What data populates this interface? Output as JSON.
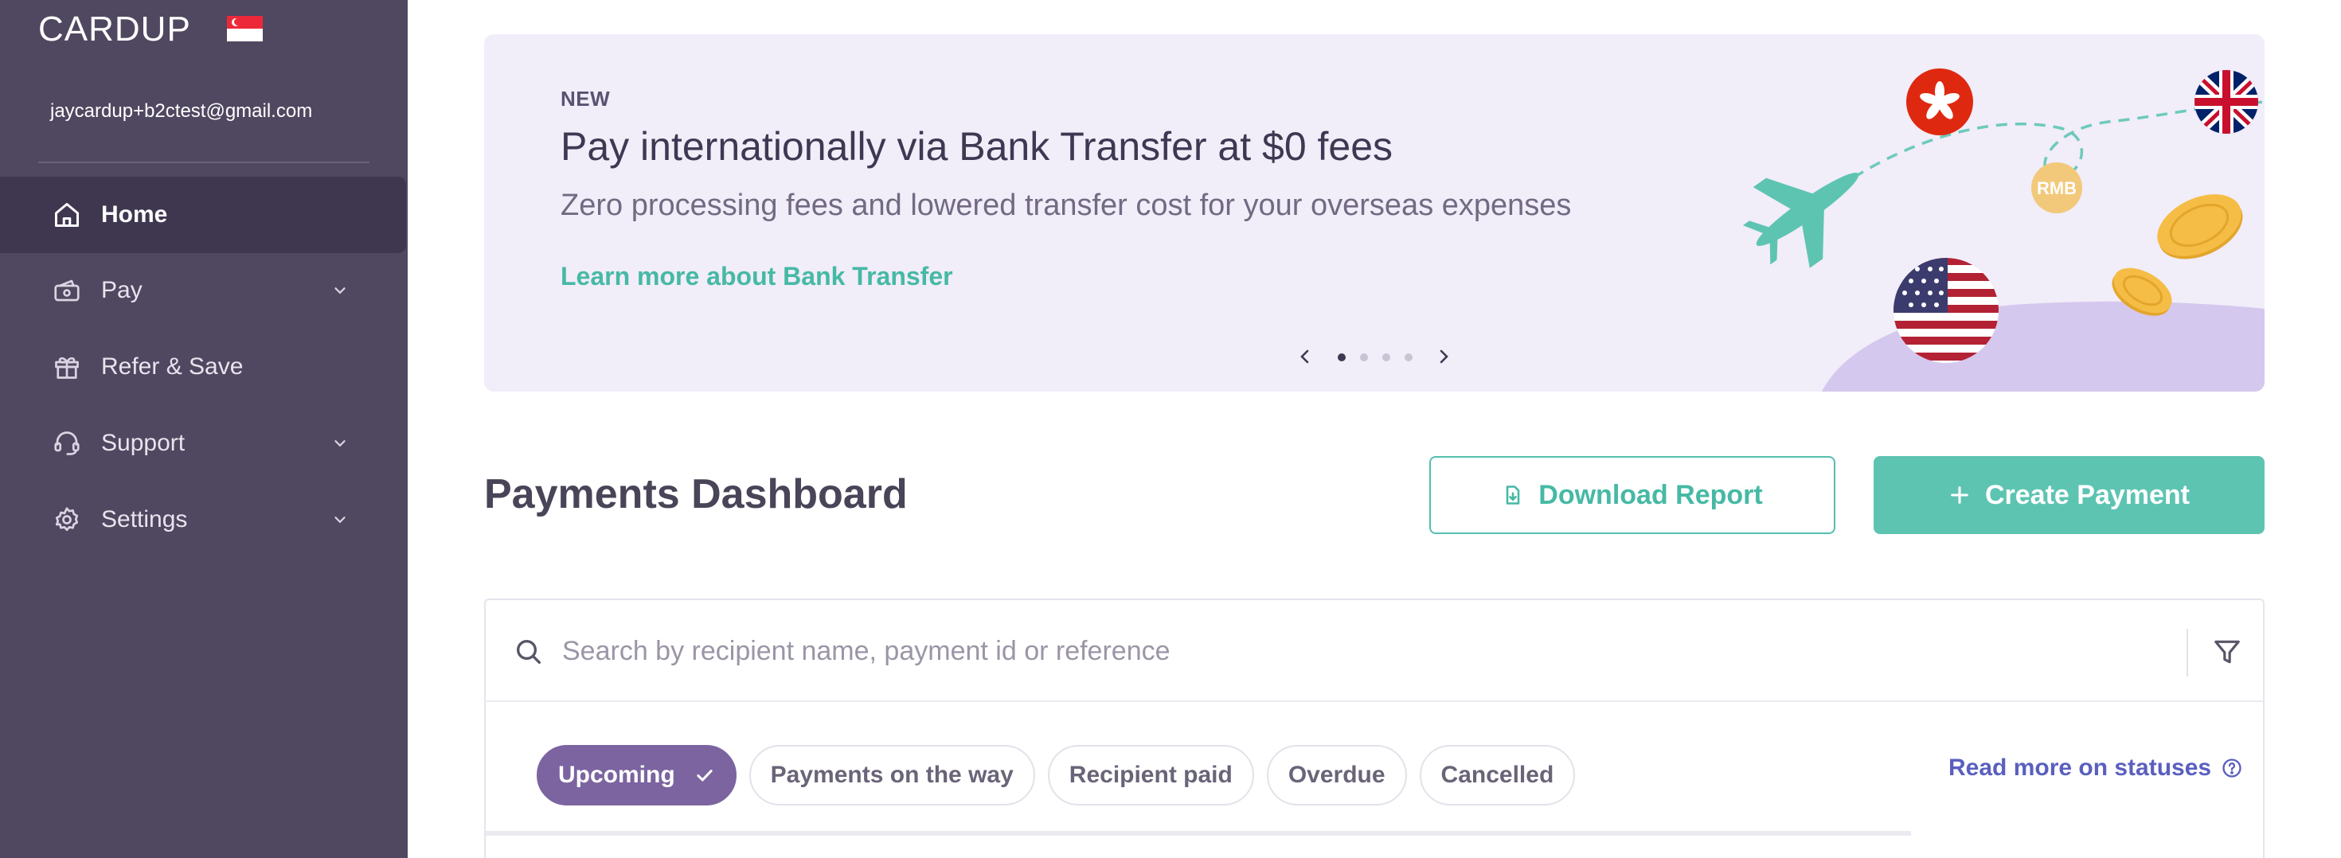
{
  "sidebar": {
    "logo_text": "CARDUP",
    "country_flag": "singapore-flag",
    "email": "jaycardup+b2ctest@gmail.com",
    "items": [
      {
        "label": "Home",
        "icon": "home-icon",
        "active": true,
        "has_chevron": false
      },
      {
        "label": "Pay",
        "icon": "pay-icon",
        "active": false,
        "has_chevron": true
      },
      {
        "label": "Refer & Save",
        "icon": "gift-icon",
        "active": false,
        "has_chevron": false
      },
      {
        "label": "Support",
        "icon": "headset-icon",
        "active": false,
        "has_chevron": true
      },
      {
        "label": "Settings",
        "icon": "gear-icon",
        "active": false,
        "has_chevron": true
      }
    ]
  },
  "banner": {
    "tag": "NEW",
    "title": "Pay internationally via Bank Transfer at $0 fees",
    "subtitle": "Zero processing fees and lowered transfer cost for your overseas expenses",
    "link": "Learn more about Bank Transfer",
    "rmb_badge": "RMB",
    "carousel_total": 4,
    "carousel_active": 1
  },
  "dashboard": {
    "title": "Payments Dashboard",
    "download_label": "Download Report",
    "create_label": "Create Payment"
  },
  "search": {
    "placeholder": "Search by recipient name, payment id or reference",
    "value": ""
  },
  "tabs": [
    {
      "label": "Upcoming",
      "active": true
    },
    {
      "label": "Payments on the way",
      "active": false
    },
    {
      "label": "Recipient paid",
      "active": false
    },
    {
      "label": "Overdue",
      "active": false
    },
    {
      "label": "Cancelled",
      "active": false
    }
  ],
  "read_more": "Read more on statuses",
  "colors": {
    "sidebar_bg": "#504760",
    "sidebar_active": "#3f3750",
    "accent_teal": "#5ec4b2",
    "tab_active": "#7b64a0",
    "link_blue": "#5a5fbf"
  }
}
